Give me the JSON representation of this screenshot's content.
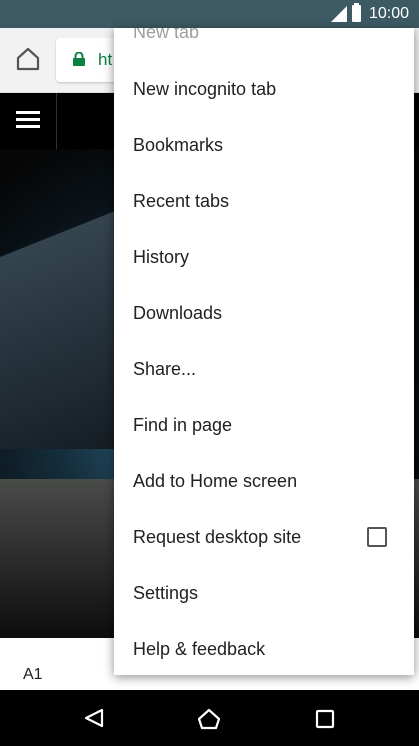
{
  "status_bar": {
    "time": "10:00",
    "icons": [
      "signal-icon",
      "battery-icon"
    ]
  },
  "toolbar": {
    "url_text": "ht",
    "icons": [
      "home-icon",
      "lock-icon"
    ],
    "lock_color": "#0b8043"
  },
  "page": {
    "bottom_label": "A1"
  },
  "menu": {
    "partial_item": "New tab",
    "items": [
      "New incognito tab",
      "Bookmarks",
      "Recent tabs",
      "History",
      "Downloads",
      "Share...",
      "Find in page",
      "Add to Home screen",
      "Request desktop site",
      "Settings",
      "Help & feedback"
    ],
    "request_desktop_site_checked": false
  },
  "nav_bar": {
    "icons": [
      "back-icon",
      "home-icon",
      "recents-icon"
    ]
  }
}
